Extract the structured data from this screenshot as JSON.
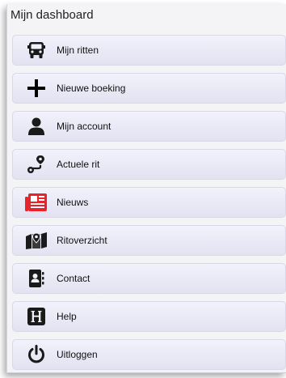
{
  "dashboard": {
    "title": "Mijn dashboard",
    "items": [
      {
        "label": "Mijn ritten",
        "icon": "bus-icon"
      },
      {
        "label": "Nieuwe boeking",
        "icon": "plus-icon"
      },
      {
        "label": "Mijn account",
        "icon": "user-icon"
      },
      {
        "label": "Actuele rit",
        "icon": "route-icon"
      },
      {
        "label": "Nieuws",
        "icon": "newspaper-icon",
        "color": "#e8232b"
      },
      {
        "label": "Ritoverzicht",
        "icon": "map-pin-icon"
      },
      {
        "label": "Contact",
        "icon": "address-book-icon"
      },
      {
        "label": "Help",
        "icon": "help-h-icon"
      },
      {
        "label": "Uitloggen",
        "icon": "power-icon"
      }
    ]
  },
  "colors": {
    "icon": "#1a1a1a",
    "accent_red": "#e8232b"
  }
}
